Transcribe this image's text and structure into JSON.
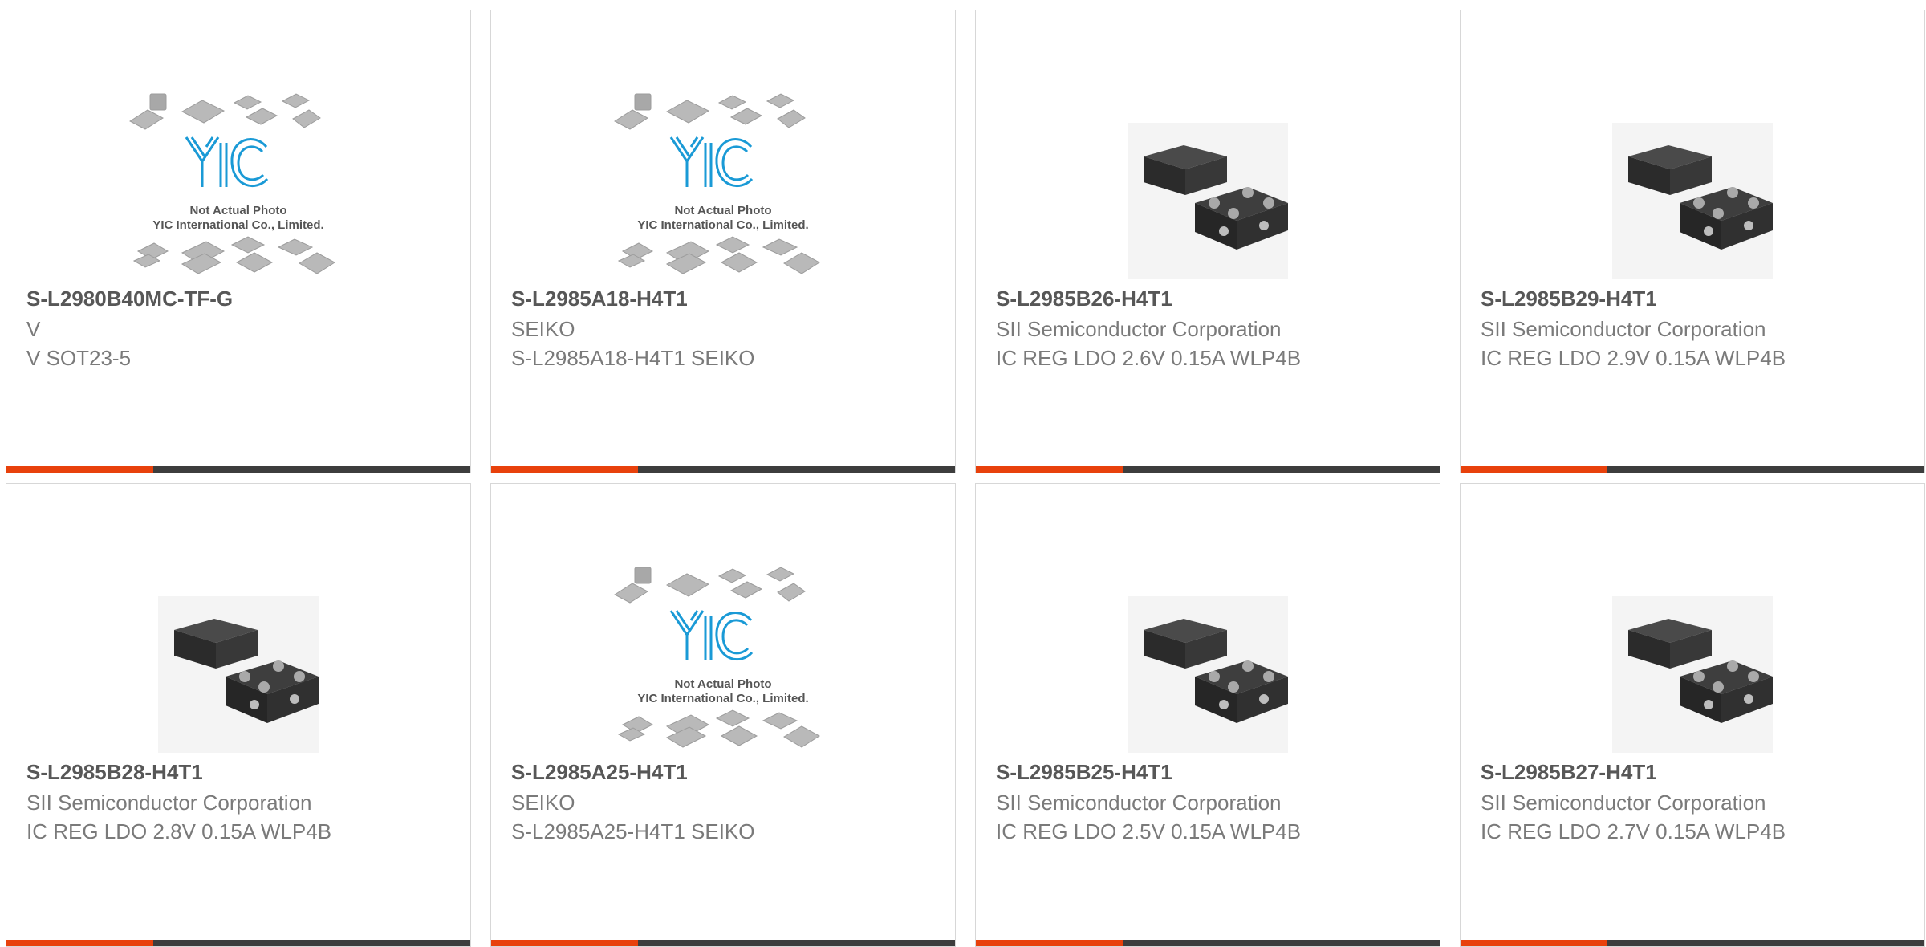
{
  "colors": {
    "accent": "#e8410c",
    "bar": "#3d3d3d",
    "logo": "#1a9ad6"
  },
  "placeholder": {
    "logo_text": "YIC",
    "caption_line1": "Not Actual Photo",
    "caption_line2": "YIC International Co., Limited."
  },
  "products": [
    {
      "part": "S-L2980B40MC-TF-G",
      "maker": "V",
      "desc": "V SOT23-5",
      "image": "placeholder"
    },
    {
      "part": "S-L2985A18-H4T1",
      "maker": "SEIKO",
      "desc": "S-L2985A18-H4T1 SEIKO",
      "image": "placeholder"
    },
    {
      "part": "S-L2985B26-H4T1",
      "maker": "SII Semiconductor Corporation",
      "desc": "IC REG LDO 2.6V 0.15A WLP4B",
      "image": "chip"
    },
    {
      "part": "S-L2985B29-H4T1",
      "maker": "SII Semiconductor Corporation",
      "desc": "IC REG LDO 2.9V 0.15A WLP4B",
      "image": "chip"
    },
    {
      "part": "S-L2985B28-H4T1",
      "maker": "SII Semiconductor Corporation",
      "desc": "IC REG LDO 2.8V 0.15A WLP4B",
      "image": "chip"
    },
    {
      "part": "S-L2985A25-H4T1",
      "maker": "SEIKO",
      "desc": "S-L2985A25-H4T1 SEIKO",
      "image": "placeholder"
    },
    {
      "part": "S-L2985B25-H4T1",
      "maker": "SII Semiconductor Corporation",
      "desc": "IC REG LDO 2.5V 0.15A WLP4B",
      "image": "chip"
    },
    {
      "part": "S-L2985B27-H4T1",
      "maker": "SII Semiconductor Corporation",
      "desc": "IC REG LDO 2.7V 0.15A WLP4B",
      "image": "chip"
    }
  ]
}
